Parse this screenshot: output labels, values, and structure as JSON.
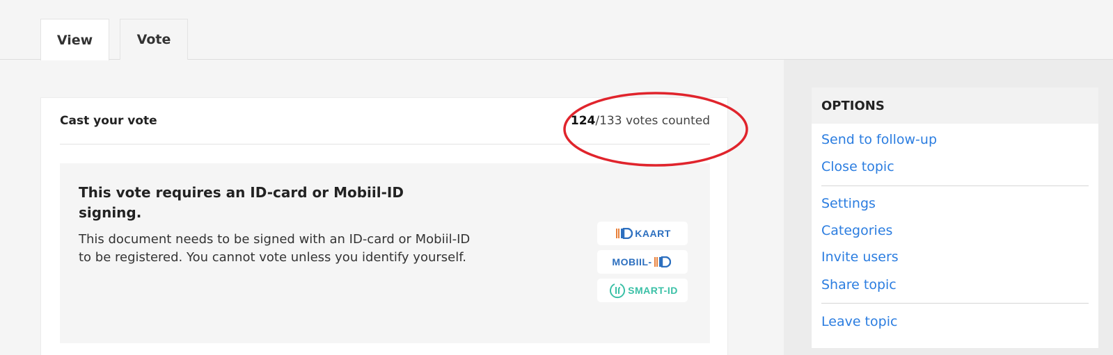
{
  "tabs": [
    {
      "label": "View"
    },
    {
      "label": "Vote"
    }
  ],
  "vote_card": {
    "title": "Cast your vote",
    "votes_counted": "124",
    "votes_total_text": "/133 votes counted",
    "id_title": "This vote requires an ID-card or Mobiil-ID signing.",
    "id_text": "This document needs to be signed with an ID-card or Mobiil-ID to be registered. You cannot vote unless you identify yourself.",
    "logos": {
      "id_card": "KAART",
      "mobiil": "MOBIIL-",
      "smart_id": "SMART-ID"
    }
  },
  "options": {
    "header": "OPTIONS",
    "items": [
      {
        "label": "Send to follow-up"
      },
      {
        "label": "Close topic"
      },
      {
        "label": "Settings"
      },
      {
        "label": "Categories"
      },
      {
        "label": "Invite users"
      },
      {
        "label": "Share topic"
      },
      {
        "label": "Leave topic"
      }
    ]
  },
  "colors": {
    "link": "#2b7de0",
    "annotation": "#e0242c",
    "smart_id": "#3ac0a6",
    "id_blue": "#2c6fbf"
  }
}
